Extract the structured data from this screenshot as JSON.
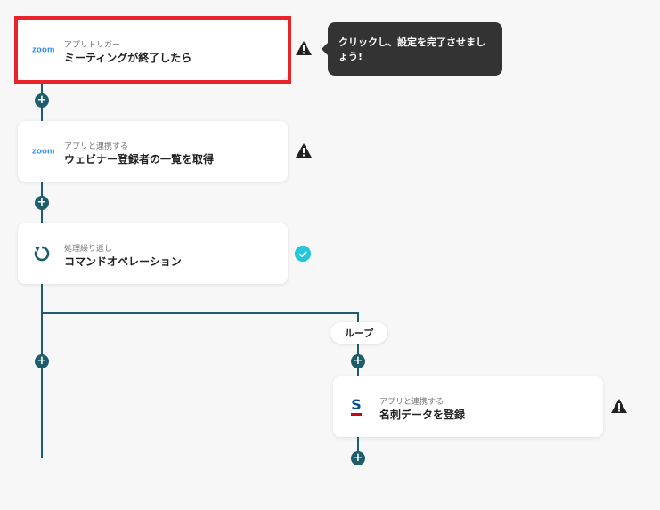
{
  "steps": [
    {
      "sub": "アプリトリガー",
      "title": "ミーティングが終了したら",
      "app": "zoom",
      "status": "warning"
    },
    {
      "sub": "アプリと連携する",
      "title": "ウェビナー登録者の一覧を取得",
      "app": "zoom",
      "status": "warning"
    },
    {
      "sub": "処理繰り返し",
      "title": "コマンドオペレーション",
      "app": "loop",
      "status": "done"
    },
    {
      "sub": "アプリと連携する",
      "title": "名刺データを登録",
      "app": "sansan",
      "status": "warning"
    }
  ],
  "tooltip": {
    "text": "クリックし、設定を完了させましょう!"
  },
  "loop_label": "ループ",
  "zoom_logo_text": "zoom",
  "sansan_logo_text": "S",
  "colors": {
    "connector": "#1d5d6b",
    "highlight": "#e8232a",
    "check": "#26c6da",
    "tooltip_bg": "#333333",
    "zoom_blue": "#2d8cff",
    "sansan_blue": "#004e98",
    "sansan_red": "#d0021b"
  }
}
